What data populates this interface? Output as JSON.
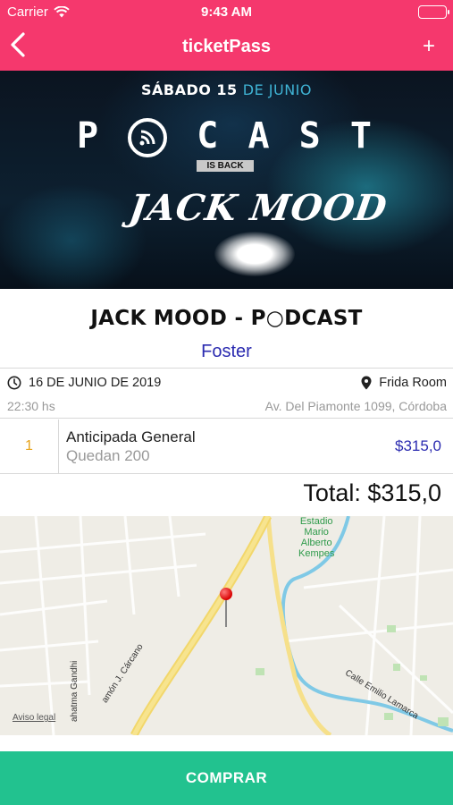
{
  "status_bar": {
    "carrier": "Carrier",
    "time": "9:43 AM"
  },
  "navbar": {
    "title": "ticketPass",
    "add_label": "+"
  },
  "banner": {
    "date_prefix": "SÁBADO 15",
    "date_month": "DE JUNIO",
    "event_word_start": "P",
    "event_word_end": [
      "C",
      "A",
      "S",
      "T"
    ],
    "subtitle": "IS BACK",
    "artist": "JACK MOOD"
  },
  "event": {
    "title": "JACK MOOD - P○DCAST",
    "venue": "Foster",
    "date": "16 DE JUNIO DE 2019",
    "time": "22:30 hs",
    "place": "Frida Room",
    "address": "Av. Del Piamonte 1099, Córdoba"
  },
  "ticket": {
    "quantity": "1",
    "name": "Anticipada General",
    "remaining": "Quedan 200",
    "price": "$315,0"
  },
  "total": "Total: $315,0",
  "map": {
    "stadium_label": [
      "Estadio",
      "Mario",
      "Alberto",
      "Kempes"
    ],
    "legal_label": "Aviso legal",
    "street_carcano": "amón J. Cárcano",
    "street_lamarca": "Calle Emilio Lamarca",
    "street_gandhi": "ahatma Gandhi"
  },
  "buy_button": "COMPRAR",
  "colors": {
    "header": "#f5386d",
    "accent": "#2b2bb0",
    "buy": "#22c28f",
    "qty": "#e8a317"
  }
}
